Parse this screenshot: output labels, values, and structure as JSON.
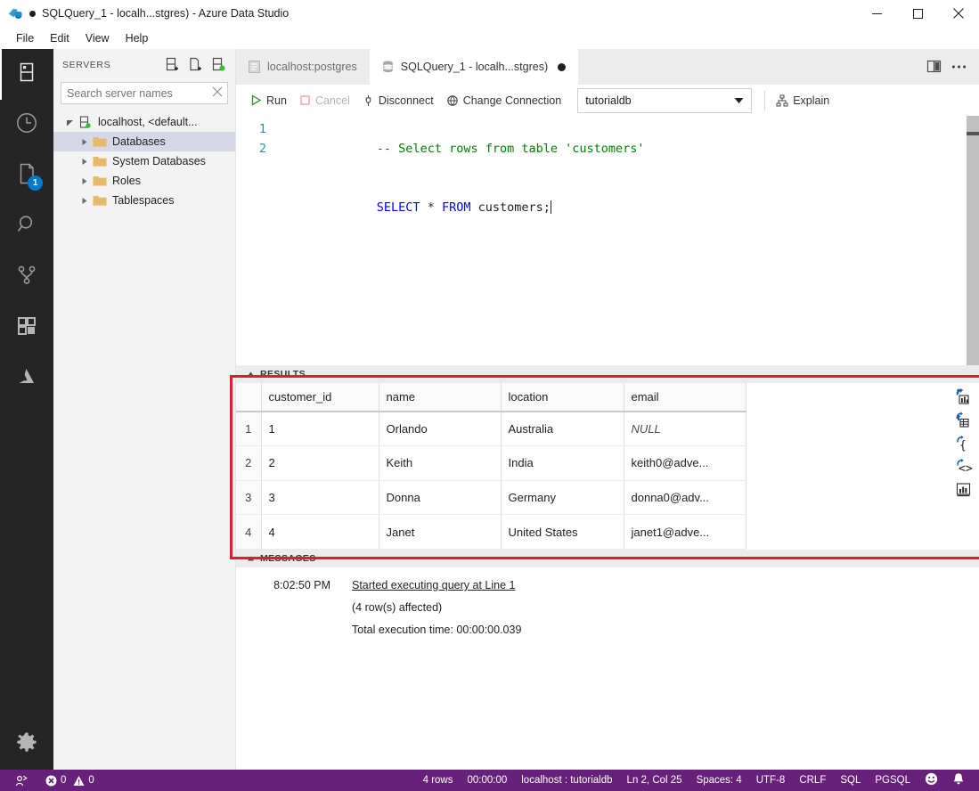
{
  "window": {
    "title": "SQLQuery_1 - localh...stgres) - Azure Data Studio",
    "dirty_dot": "●",
    "minimize_label": "Minimize",
    "maximize_label": "Maximize",
    "close_label": "Close"
  },
  "menubar": {
    "items": [
      {
        "label": "File"
      },
      {
        "label": "Edit"
      },
      {
        "label": "View"
      },
      {
        "label": "Help"
      }
    ]
  },
  "activitybar": {
    "items": [
      {
        "name": "servers",
        "tooltip": "Servers",
        "badge": ""
      },
      {
        "name": "history",
        "tooltip": "History",
        "badge": ""
      },
      {
        "name": "notebooks",
        "tooltip": "Notebooks",
        "badge": "1"
      },
      {
        "name": "search",
        "tooltip": "Search",
        "badge": ""
      },
      {
        "name": "source-control",
        "tooltip": "Source Control",
        "badge": ""
      },
      {
        "name": "extensions",
        "tooltip": "Extensions",
        "badge": ""
      },
      {
        "name": "azure",
        "tooltip": "Azure",
        "badge": ""
      }
    ],
    "settings_tooltip": "Manage"
  },
  "sidebar": {
    "title": "SERVERS",
    "actions": [
      {
        "name": "new-connection",
        "tooltip": "New Connection"
      },
      {
        "name": "new-server-group",
        "tooltip": "New Server Group"
      },
      {
        "name": "active-connections",
        "tooltip": "Show Active Connections"
      }
    ],
    "search": {
      "placeholder": "Search server names",
      "value": "",
      "clear_tooltip": "Clear"
    },
    "tree": [
      {
        "label": "localhost, <default...",
        "level": 0,
        "icon": "server-icon",
        "expanded": true,
        "selected": false
      },
      {
        "label": "Databases",
        "level": 1,
        "icon": "folder-icon",
        "expanded": false,
        "selected": true
      },
      {
        "label": "System Databases",
        "level": 1,
        "icon": "folder-icon",
        "expanded": false,
        "selected": false
      },
      {
        "label": "Roles",
        "level": 1,
        "icon": "folder-icon",
        "expanded": false,
        "selected": false
      },
      {
        "label": "Tablespaces",
        "level": 1,
        "icon": "folder-icon",
        "expanded": false,
        "selected": false
      }
    ]
  },
  "tabs": [
    {
      "label": "localhost:postgres",
      "icon": "dashboard-icon",
      "active": false,
      "dirty": false
    },
    {
      "label": "SQLQuery_1 - localh...stgres)",
      "icon": "database-icon",
      "active": true,
      "dirty": true
    }
  ],
  "tabbar_actions": [
    {
      "name": "split-editor",
      "tooltip": "Split Editor"
    },
    {
      "name": "more-actions",
      "tooltip": "More Actions..."
    }
  ],
  "query_toolbar": {
    "run_label": "Run",
    "cancel_label": "Cancel",
    "disconnect_label": "Disconnect",
    "change_connection_label": "Change Connection",
    "database_value": "tutorialdb",
    "explain_label": "Explain"
  },
  "editor": {
    "lines": [
      {
        "number": "1",
        "text": "-- Select rows from table 'customers'",
        "kind": "comment"
      },
      {
        "number": "2",
        "text": "SELECT * FROM customers;",
        "kind": "sql"
      }
    ],
    "line2_tokens": [
      {
        "t": "SELECT",
        "c": "kw"
      },
      {
        "t": " * ",
        "c": "plain"
      },
      {
        "t": "FROM",
        "c": "kw"
      },
      {
        "t": " customers;",
        "c": "plain"
      }
    ]
  },
  "results": {
    "panel_title": "RESULTS",
    "columns": [
      "customer_id",
      "name",
      "location",
      "email"
    ],
    "rows": [
      {
        "n": "1",
        "cells": [
          "1",
          "Orlando",
          "Australia",
          "NULL"
        ],
        "null_flags": [
          false,
          false,
          false,
          true
        ]
      },
      {
        "n": "2",
        "cells": [
          "2",
          "Keith",
          "India",
          "keith0@adve..."
        ],
        "null_flags": [
          false,
          false,
          false,
          false
        ]
      },
      {
        "n": "3",
        "cells": [
          "3",
          "Donna",
          "Germany",
          "donna0@adv..."
        ],
        "null_flags": [
          false,
          false,
          false,
          false
        ]
      },
      {
        "n": "4",
        "cells": [
          "4",
          "Janet",
          "United States",
          "janet1@adve..."
        ],
        "null_flags": [
          false,
          false,
          false,
          false
        ]
      }
    ],
    "tools": [
      {
        "name": "save-as-csv",
        "tooltip": "Save As CSV"
      },
      {
        "name": "save-as-excel",
        "tooltip": "Save As Excel"
      },
      {
        "name": "save-as-json",
        "tooltip": "Save As JSON"
      },
      {
        "name": "save-as-xml",
        "tooltip": "Save As XML"
      },
      {
        "name": "view-as-chart",
        "tooltip": "View As Chart"
      }
    ]
  },
  "messages": {
    "panel_title": "MESSAGES",
    "entries": [
      {
        "time": "8:02:50 PM",
        "text": "Started executing query at Line 1",
        "link": true
      },
      {
        "time": "",
        "text": "(4 row(s) affected)",
        "link": false
      },
      {
        "time": "",
        "text": "Total execution time: 00:00:00.039",
        "link": false
      }
    ]
  },
  "statusbar": {
    "left": [
      {
        "name": "remote-indicator",
        "icon": "remote-icon",
        "label": ""
      },
      {
        "name": "problems",
        "icon": "error-warning-icon",
        "label": "0",
        "label2": "0"
      }
    ],
    "errors_count": "0",
    "warnings_count": "0",
    "right": [
      {
        "name": "row-count",
        "label": "4 rows"
      },
      {
        "name": "execution-time",
        "label": "00:00:00"
      },
      {
        "name": "connection",
        "label": "localhost : tutorialdb"
      },
      {
        "name": "cursor-position",
        "label": "Ln 2, Col 25"
      },
      {
        "name": "indentation",
        "label": "Spaces: 4"
      },
      {
        "name": "encoding",
        "label": "UTF-8"
      },
      {
        "name": "eol",
        "label": "CRLF"
      },
      {
        "name": "language-mode",
        "label": "SQL"
      },
      {
        "name": "provider",
        "label": "PGSQL"
      }
    ],
    "feedback_tooltip": "Tweet Feedback",
    "notifications_tooltip": "No Notifications"
  },
  "colors": {
    "status_bar": "#68217a",
    "activity_bar": "#252526",
    "sidebar": "#f3f3f3",
    "accent_blue": "#007acc",
    "highlight_red": "#e8192c",
    "keyword_blue": "#0000ff",
    "comment_green": "#008000",
    "line_number": "#2b91af",
    "selection": "#d6d8e8"
  }
}
